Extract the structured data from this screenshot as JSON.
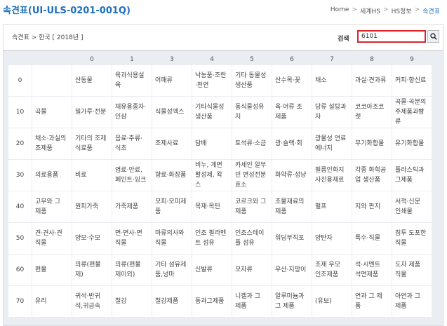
{
  "header": {
    "title": "속견표(UI-ULS-0201-001Q)",
    "breadcrumb": [
      "Home",
      "세계HS",
      "HS정보",
      "속견표"
    ]
  },
  "panel": {
    "path": "속견표 > 한국 [ 2018년 ]",
    "search_label": "검색",
    "search_value": "6101"
  },
  "grid": {
    "columns": [
      "0",
      "1",
      "3",
      "4",
      "5",
      "6",
      "7",
      "8",
      "9"
    ],
    "rows": [
      {
        "code": "0",
        "cells": [
          "",
          "산동물",
          "육과식용설\n육",
          "어패류",
          "낙농품·조란\n·천연",
          "기타 동물성\n생산품",
          "산수목·꽃",
          "채소",
          "과실·견과류",
          "커피·향신료"
        ]
      },
      {
        "code": "10",
        "cells": [
          "곡물",
          "밀가루·전분",
          "채유용종자·\n인삼",
          "식물성엑스",
          "기타식물성\n생산품",
          "동식물성유\n지",
          "육·어류 조\n제품",
          "당류 설탕과\n자",
          "코코아조코\n렛",
          "곡물·곡분의\n주제품과빵\n류"
        ]
      },
      {
        "code": "20",
        "cells": [
          "채소·과실의\n조제품",
          "기타의 조제\n식료품",
          "음료·주류·\n식초",
          "조제사료",
          "담배",
          "토석류·소금",
          "광·슬랙·회",
          "광물성 연료\n에너지",
          "무기화합물",
          "유기화합물"
        ]
      },
      {
        "code": "30",
        "cells": [
          "의료용품",
          "비료",
          "염료·안료,\n페인트·잉크",
          "향료·화장품",
          "비누, 계면\n활성제, 왁\n스",
          "카세인 알부\n민 변성전분\n효소",
          "화약류·성냥",
          "필름인화지\n사진용재료",
          "각종 화학공\n업 생산품",
          "플라스틱과\n그제품"
        ]
      },
      {
        "code": "40",
        "cells": [
          "고무와 그\n제품",
          "원피가죽",
          "가죽제품",
          "모피·모피제\n품",
          "목재·목탄",
          "코르크와 그\n제품",
          "조물재료의\n제품",
          "펄프",
          "지와 판지",
          "서적·신문\n인쇄물"
        ]
      },
      {
        "code": "50",
        "cells": [
          "견·견사·견\n직물",
          "양모·수모",
          "면·면사·면\n직물",
          "마류의사와\n직물",
          "인조 필라멘\n트 섬유",
          "인조스테이\n플 섬유",
          "워딩부직포",
          "양탄자",
          "특수·직물",
          "침투 도포한\n직물"
        ]
      },
      {
        "code": "60",
        "cells": [
          "편물",
          "의류(편물\n제)",
          "의류(편물\n제이외)",
          "기타 섬유제\n품,넝마",
          "신발류",
          "모자류",
          "우산·지팡이",
          "조제 우모\n인조제품",
          "석·시멘트\n석면제품",
          "도자 제품\n직물"
        ]
      },
      {
        "code": "70",
        "cells": [
          "유리",
          "귀석·반귀\n석,귀금속",
          "철강",
          "철강제품",
          "동과그제품",
          "니켈과 그\n제품",
          "알루미늄과\n그 제품",
          "(유보)",
          "연과 그 제\n품",
          "아연과 그\n제품"
        ]
      }
    ]
  }
}
